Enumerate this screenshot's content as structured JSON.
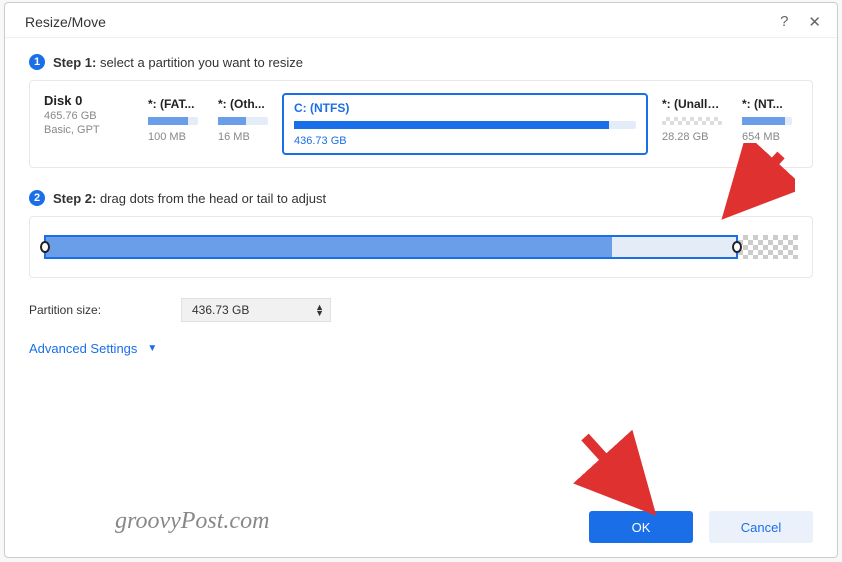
{
  "dialog": {
    "title": "Resize/Move"
  },
  "step1": {
    "num": "1",
    "label_bold": "Step 1:",
    "label_rest": " select a partition you want to resize"
  },
  "disk": {
    "name": "Disk 0",
    "size": "465.76 GB",
    "type": "Basic, GPT"
  },
  "partitions": [
    {
      "label": "*: (FAT...",
      "size": "100 MB",
      "fill_pct": 80
    },
    {
      "label": "*: (Oth...",
      "size": "16 MB",
      "fill_pct": 55
    },
    {
      "label": "C: (NTFS)",
      "size": "436.73 GB",
      "fill_pct": 92,
      "selected": true
    },
    {
      "label": "*: (Unallo...",
      "size": "28.28 GB",
      "unallocated": true
    },
    {
      "label": "*: (NT...",
      "size": "654 MB",
      "fill_pct": 85
    }
  ],
  "step2": {
    "num": "2",
    "label_bold": "Step 2:",
    "label_rest": " drag dots from the head or tail to adjust"
  },
  "slider": {
    "alloc_pct": 92,
    "used_pct": 82
  },
  "partition_size": {
    "label": "Partition size:",
    "value": "436.73 GB"
  },
  "advanced_label": "Advanced Settings",
  "buttons": {
    "ok": "OK",
    "cancel": "Cancel"
  },
  "watermark": "groovyPost.com"
}
